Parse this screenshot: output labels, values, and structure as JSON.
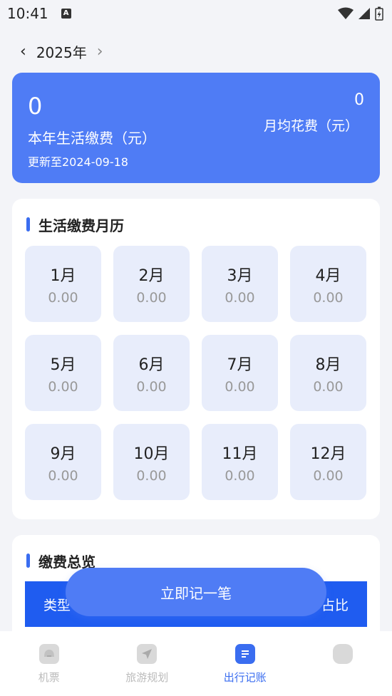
{
  "status": {
    "time": "10:41",
    "notif_icon": "A"
  },
  "year_nav": {
    "year": "2025年",
    "prev_icon": "‹",
    "next_icon": "›"
  },
  "summary": {
    "total_value": "0",
    "total_label": "本年生活缴费（元）",
    "updated": "更新至2024-09-18",
    "avg_value": "0",
    "avg_label": "月均花费（元）"
  },
  "calendar": {
    "title": "生活缴费月历",
    "months": [
      {
        "label": "1月",
        "value": "0.00"
      },
      {
        "label": "2月",
        "value": "0.00"
      },
      {
        "label": "3月",
        "value": "0.00"
      },
      {
        "label": "4月",
        "value": "0.00"
      },
      {
        "label": "5月",
        "value": "0.00"
      },
      {
        "label": "6月",
        "value": "0.00"
      },
      {
        "label": "7月",
        "value": "0.00"
      },
      {
        "label": "8月",
        "value": "0.00"
      },
      {
        "label": "9月",
        "value": "0.00"
      },
      {
        "label": "10月",
        "value": "0.00"
      },
      {
        "label": "11月",
        "value": "0.00"
      },
      {
        "label": "12月",
        "value": "0.00"
      }
    ]
  },
  "overview": {
    "title": "缴费总览",
    "col_type": "类型",
    "col_ratio": "占比"
  },
  "fab": {
    "label": "立即记一笔"
  },
  "bottom_nav": {
    "items": [
      {
        "label": "机票",
        "icon": "ticket-icon"
      },
      {
        "label": "旅游规划",
        "icon": "navigation-icon"
      },
      {
        "label": "出行记账",
        "icon": "document-icon"
      },
      {
        "label": "",
        "icon": "profile-icon"
      }
    ]
  },
  "colors": {
    "accent": "#4f7cf5",
    "header_blue": "#1f5cf0",
    "cell_bg": "#e8edfb"
  }
}
